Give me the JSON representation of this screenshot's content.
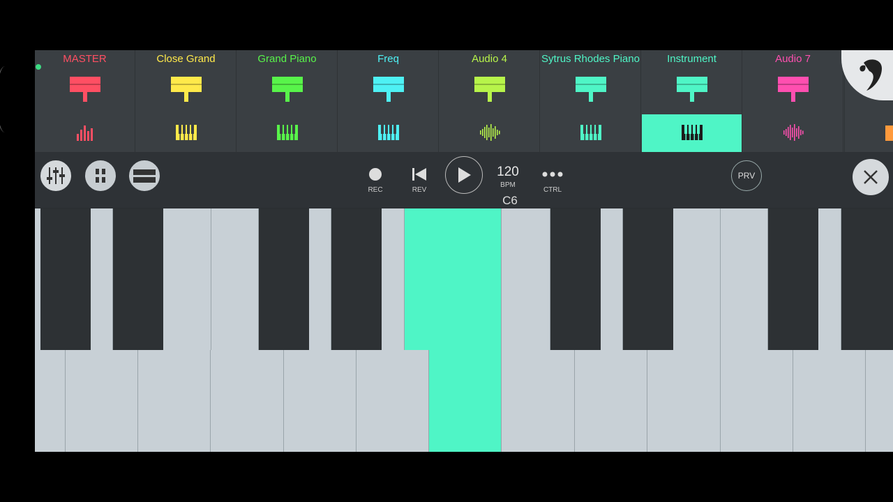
{
  "channels": [
    {
      "name": "MASTER",
      "color": "#ff4f63",
      "type": "mixer-icon"
    },
    {
      "name": "Close Grand",
      "color": "#ffe94a",
      "type": "piano-keys-icon"
    },
    {
      "name": "Grand Piano",
      "color": "#58f44a",
      "type": "piano-keys-icon"
    },
    {
      "name": "Freq",
      "color": "#4ef1f4",
      "type": "piano-keys-icon"
    },
    {
      "name": "Audio 4",
      "color": "#b7f44a",
      "type": "waveform-icon"
    },
    {
      "name": "Sytrus Rhodes Piano",
      "color": "#4ff5c6",
      "type": "piano-keys-icon"
    },
    {
      "name": "Instrument",
      "color": "#4ff5c6",
      "type": "piano-keys-icon",
      "selected": true
    },
    {
      "name": "Audio 7",
      "color": "#ff4fb0",
      "type": "waveform-icon"
    }
  ],
  "transport": {
    "rec_label": "REC",
    "rev_label": "REV",
    "bpm_value": "120",
    "bpm_label": "BPM",
    "ctrl_label": "CTRL",
    "prv_label": "PRV"
  },
  "keyboard": {
    "current_note": "C6",
    "highlight_color": "#4ff5c6"
  }
}
